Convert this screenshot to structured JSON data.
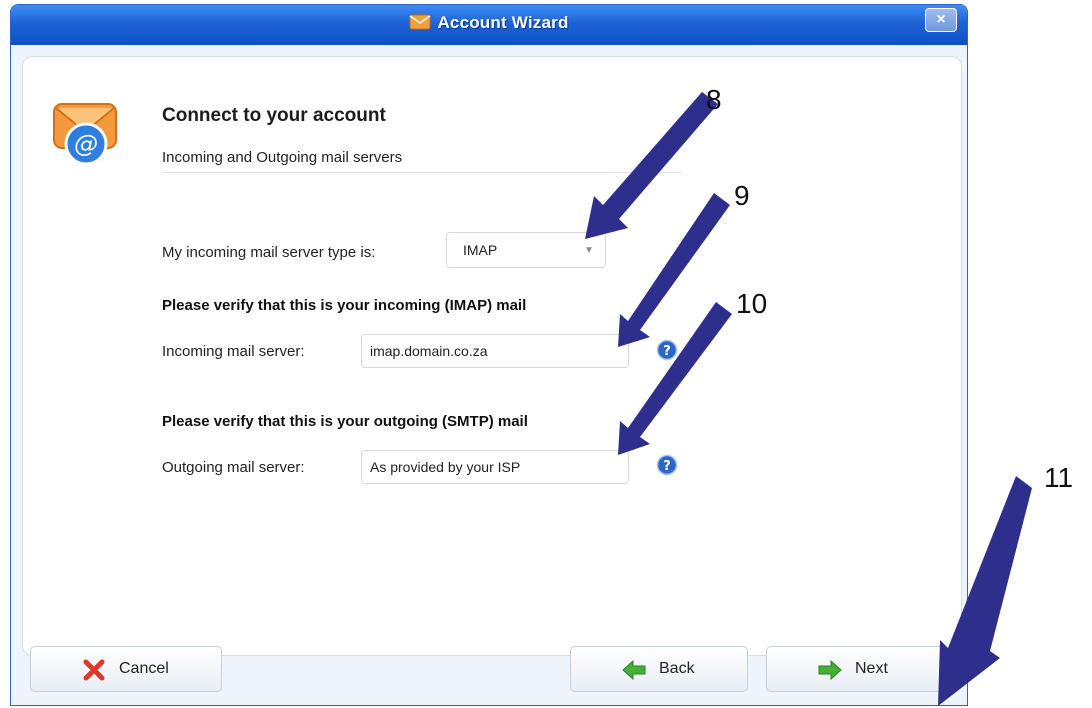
{
  "window": {
    "title": "Account Wizard",
    "close_label": "×"
  },
  "header": {
    "title": "Connect to your account",
    "subtitle": "Incoming and Outgoing mail servers"
  },
  "form": {
    "server_type_label": "My incoming mail server type is:",
    "server_type_value": "IMAP",
    "incoming_heading": "Please verify that this is your incoming (IMAP) mail",
    "incoming_label": "Incoming mail server:",
    "incoming_value": "imap.domain.co.za",
    "outgoing_heading": "Please verify that this is your outgoing (SMTP) mail",
    "outgoing_label": "Outgoing mail server:",
    "outgoing_value": "As provided by your ISP"
  },
  "buttons": {
    "cancel": "Cancel",
    "back": "Back",
    "next": "Next"
  },
  "annotations": {
    "n8": "8",
    "n9": "9",
    "n10": "10",
    "n11": "11"
  },
  "colors": {
    "title_bar": "#1e63d6",
    "arrow": "#2e2f8c",
    "cancel_icon": "#d93a2b",
    "nav_icon": "#44b035",
    "help_icon": "#2d66c9"
  }
}
